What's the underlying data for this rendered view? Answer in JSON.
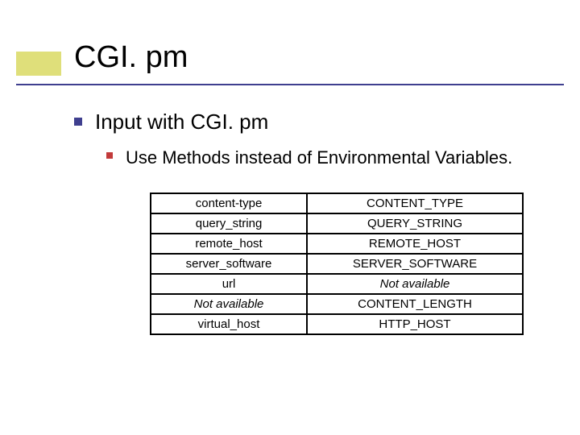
{
  "title": "CGI. pm",
  "bullet1": "Input with CGI. pm",
  "bullet2": "Use Methods instead of Environmental Variables.",
  "table": {
    "rows": [
      {
        "left": "content-type",
        "leftItalic": false,
        "right": "CONTENT_TYPE",
        "rightItalic": false
      },
      {
        "left": "query_string",
        "leftItalic": false,
        "right": "QUERY_STRING",
        "rightItalic": false
      },
      {
        "left": "remote_host",
        "leftItalic": false,
        "right": "REMOTE_HOST",
        "rightItalic": false
      },
      {
        "left": "server_software",
        "leftItalic": false,
        "right": "SERVER_SOFTWARE",
        "rightItalic": false
      },
      {
        "left": "url",
        "leftItalic": false,
        "right": "Not available",
        "rightItalic": true
      },
      {
        "left": "Not available",
        "leftItalic": true,
        "right": "CONTENT_LENGTH",
        "rightItalic": false
      },
      {
        "left": "virtual_host",
        "leftItalic": false,
        "right": "HTTP_HOST",
        "rightItalic": false
      }
    ]
  }
}
